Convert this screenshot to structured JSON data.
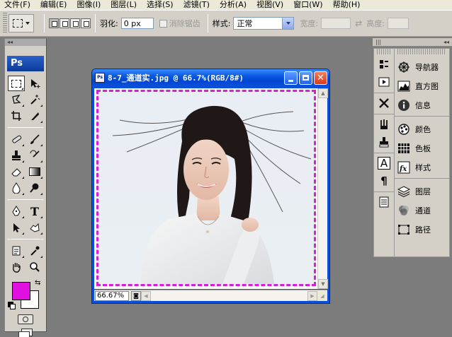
{
  "menu": [
    "文件(F)",
    "编辑(E)",
    "图像(I)",
    "图层(L)",
    "选择(S)",
    "滤镜(T)",
    "分析(A)",
    "视图(V)",
    "窗口(W)",
    "帮助(H)"
  ],
  "options": {
    "feather_label": "羽化:",
    "feather_value": "0 px",
    "antialias_label": "消除锯齿",
    "style_label": "样式:",
    "style_value": "正常",
    "width_label": "宽度:",
    "height_label": "高度:"
  },
  "toolbox": {
    "logo": "Ps",
    "foreground_color": "#e010e0",
    "background_color": "#ffffff"
  },
  "document": {
    "title": "8-7_通道实.jpg @ 66.7%(RGB/8#)",
    "zoom": "66.67%",
    "selection_color": "#d61fd6"
  },
  "panels": {
    "group1": [
      "导航器",
      "直方图",
      "信息"
    ],
    "group2": [
      "颜色",
      "色板",
      "样式"
    ],
    "group3": [
      "图层",
      "通道",
      "路径"
    ]
  },
  "dock_collapse": "◂◂"
}
